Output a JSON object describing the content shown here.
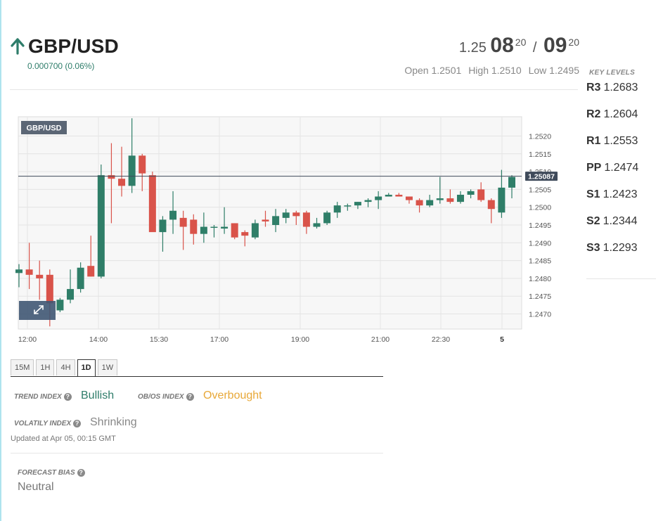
{
  "header": {
    "pair": "GBP/USD",
    "change": "0.000700 (0.06%)",
    "quote": {
      "bid_prefix": "1.25",
      "bid_big": "08",
      "bid_sup": "20",
      "separator": "/",
      "ask_big": "09",
      "ask_sup": "20"
    },
    "open": "Open 1.2501",
    "high": "High 1.2510",
    "low": "Low 1.2495"
  },
  "key_levels": {
    "title": "KEY LEVELS",
    "levels": [
      {
        "name": "R3",
        "value": "1.2683"
      },
      {
        "name": "R2",
        "value": "1.2604"
      },
      {
        "name": "R1",
        "value": "1.2553"
      },
      {
        "name": "PP",
        "value": "1.2474"
      },
      {
        "name": "S1",
        "value": "1.2423"
      },
      {
        "name": "S2",
        "value": "1.2344"
      },
      {
        "name": "S3",
        "value": "1.2293"
      }
    ]
  },
  "chart": {
    "badge": "GBP/USD",
    "current_price_label": "1.25087",
    "y_ticks": [
      "1.2520",
      "1.2515",
      "1.2510",
      "1.2505",
      "1.2500",
      "1.2495",
      "1.2490",
      "1.2485",
      "1.2480",
      "1.2475",
      "1.2470"
    ],
    "x_ticks": [
      "12:00",
      "14:00",
      "15:30",
      "17:00",
      "19:00",
      "21:00",
      "22:30",
      "5"
    ],
    "colors": {
      "up": "#2f7e68",
      "down": "#d9534a",
      "price_line": "#3f4a5a",
      "badge_bg": "#5b6675"
    }
  },
  "chart_data": {
    "type": "candlestick",
    "title": "GBP/USD",
    "ylim": [
      1.2466,
      1.2526
    ],
    "current_price": 1.25087,
    "x": [
      "12:00",
      "14:00",
      "15:30",
      "17:00",
      "19:00",
      "21:00",
      "22:30",
      "5"
    ],
    "candles": [
      {
        "o": 1.24815,
        "h": 1.2484,
        "l": 1.24775,
        "c": 1.24825
      },
      {
        "o": 1.24825,
        "h": 1.249,
        "l": 1.2477,
        "c": 1.2481
      },
      {
        "o": 1.2481,
        "h": 1.2485,
        "l": 1.2474,
        "c": 1.248
      },
      {
        "o": 1.2481,
        "h": 1.24825,
        "l": 1.24665,
        "c": 1.2473
      },
      {
        "o": 1.2471,
        "h": 1.24745,
        "l": 1.24705,
        "c": 1.2474
      },
      {
        "o": 1.2474,
        "h": 1.24825,
        "l": 1.2473,
        "c": 1.2477
      },
      {
        "o": 1.2477,
        "h": 1.24845,
        "l": 1.2476,
        "c": 1.2483
      },
      {
        "o": 1.24835,
        "h": 1.2492,
        "l": 1.24805,
        "c": 1.24805
      },
      {
        "o": 1.24805,
        "h": 1.2512,
        "l": 1.248,
        "c": 1.2509
      },
      {
        "o": 1.2509,
        "h": 1.2518,
        "l": 1.24955,
        "c": 1.2508
      },
      {
        "o": 1.2508,
        "h": 1.2517,
        "l": 1.2503,
        "c": 1.2506
      },
      {
        "o": 1.2506,
        "h": 1.2525,
        "l": 1.2504,
        "c": 1.25145
      },
      {
        "o": 1.25145,
        "h": 1.2515,
        "l": 1.25045,
        "c": 1.25095
      },
      {
        "o": 1.2509,
        "h": 1.251,
        "l": 1.24935,
        "c": 1.2493
      },
      {
        "o": 1.2493,
        "h": 1.24975,
        "l": 1.24875,
        "c": 1.24965
      },
      {
        "o": 1.24965,
        "h": 1.25045,
        "l": 1.24925,
        "c": 1.2499
      },
      {
        "o": 1.2497,
        "h": 1.2499,
        "l": 1.2488,
        "c": 1.24945
      },
      {
        "o": 1.24965,
        "h": 1.2498,
        "l": 1.24895,
        "c": 1.24925
      },
      {
        "o": 1.24925,
        "h": 1.24985,
        "l": 1.249,
        "c": 1.24945
      },
      {
        "o": 1.24945,
        "h": 1.2495,
        "l": 1.24915,
        "c": 1.24945
      },
      {
        "o": 1.2494,
        "h": 1.25,
        "l": 1.24925,
        "c": 1.24945
      },
      {
        "o": 1.24955,
        "h": 1.24955,
        "l": 1.2491,
        "c": 1.24915
      },
      {
        "o": 1.2493,
        "h": 1.24935,
        "l": 1.2489,
        "c": 1.2492
      },
      {
        "o": 1.24915,
        "h": 1.24965,
        "l": 1.2491,
        "c": 1.24955
      },
      {
        "o": 1.24965,
        "h": 1.2499,
        "l": 1.24945,
        "c": 1.2496
      },
      {
        "o": 1.2495,
        "h": 1.24995,
        "l": 1.2493,
        "c": 1.24975
      },
      {
        "o": 1.2497,
        "h": 1.24995,
        "l": 1.24955,
        "c": 1.24985
      },
      {
        "o": 1.24985,
        "h": 1.2499,
        "l": 1.2495,
        "c": 1.24975
      },
      {
        "o": 1.24985,
        "h": 1.2499,
        "l": 1.24925,
        "c": 1.24945
      },
      {
        "o": 1.24945,
        "h": 1.2497,
        "l": 1.2494,
        "c": 1.24955
      },
      {
        "o": 1.24955,
        "h": 1.2499,
        "l": 1.2495,
        "c": 1.24985
      },
      {
        "o": 1.24985,
        "h": 1.25015,
        "l": 1.2497,
        "c": 1.25005
      },
      {
        "o": 1.25005,
        "h": 1.2501,
        "l": 1.2499,
        "c": 1.25005
      },
      {
        "o": 1.25005,
        "h": 1.25015,
        "l": 1.24995,
        "c": 1.25015
      },
      {
        "o": 1.25015,
        "h": 1.25025,
        "l": 1.25,
        "c": 1.2502
      },
      {
        "o": 1.2502,
        "h": 1.25045,
        "l": 1.24995,
        "c": 1.2503
      },
      {
        "o": 1.2503,
        "h": 1.2504,
        "l": 1.2503,
        "c": 1.25035
      },
      {
        "o": 1.25035,
        "h": 1.2504,
        "l": 1.2503,
        "c": 1.2503
      },
      {
        "o": 1.2503,
        "h": 1.2503,
        "l": 1.2501,
        "c": 1.2502
      },
      {
        "o": 1.2502,
        "h": 1.25025,
        "l": 1.24985,
        "c": 1.25005
      },
      {
        "o": 1.25005,
        "h": 1.25035,
        "l": 1.25,
        "c": 1.2502
      },
      {
        "o": 1.2502,
        "h": 1.25085,
        "l": 1.2501,
        "c": 1.25025
      },
      {
        "o": 1.25025,
        "h": 1.2505,
        "l": 1.2501,
        "c": 1.25015
      },
      {
        "o": 1.25015,
        "h": 1.25045,
        "l": 1.2501,
        "c": 1.25035
      },
      {
        "o": 1.25035,
        "h": 1.2505,
        "l": 1.25025,
        "c": 1.25045
      },
      {
        "o": 1.2505,
        "h": 1.2507,
        "l": 1.25015,
        "c": 1.2502
      },
      {
        "o": 1.2502,
        "h": 1.25025,
        "l": 1.24955,
        "c": 1.24995
      },
      {
        "o": 1.24985,
        "h": 1.25105,
        "l": 1.2497,
        "c": 1.25055
      },
      {
        "o": 1.25055,
        "h": 1.2509,
        "l": 1.25025,
        "c": 1.25085
      }
    ]
  },
  "tabs": [
    "15M",
    "1H",
    "4H",
    "1D",
    "1W"
  ],
  "active_tab": "1D",
  "indices": {
    "trend_label": "TREND INDEX",
    "trend_value": "Bullish",
    "trend_color": "#2e7d6a",
    "obos_label": "OB/OS INDEX",
    "obos_value": "Overbought",
    "obos_color": "#e8a838",
    "volatility_label": "VOLATILY INDEX",
    "volatility_value": "Shrinking",
    "volatility_color": "#888888",
    "help_glyph": "?",
    "updated": "Updated at Apr 05, 00:15 GMT"
  },
  "forecast": {
    "label": "FORECAST BIAS",
    "value": "Neutral"
  }
}
